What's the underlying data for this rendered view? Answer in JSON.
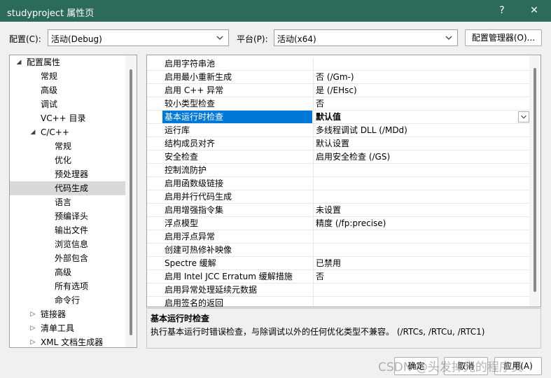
{
  "window": {
    "title": "studyproject 属性页",
    "help_glyph": "?",
    "close_glyph": "✕"
  },
  "config": {
    "label": "配置(C):",
    "value": "活动(Debug)"
  },
  "platform": {
    "label": "平台(P):",
    "value": "活动(x64)"
  },
  "config_manager_label": "配置管理器(O)...",
  "tree": [
    {
      "label": "配置属性",
      "glyph": "◢"
    },
    {
      "label": "常规"
    },
    {
      "label": "高级"
    },
    {
      "label": "调试"
    },
    {
      "label": "VC++ 目录"
    },
    {
      "label": "C/C++",
      "glyph": "◢"
    },
    {
      "label": "常规"
    },
    {
      "label": "优化"
    },
    {
      "label": "预处理器"
    },
    {
      "label": "代码生成"
    },
    {
      "label": "语言"
    },
    {
      "label": "预编译头"
    },
    {
      "label": "输出文件"
    },
    {
      "label": "浏览信息"
    },
    {
      "label": "外部包含"
    },
    {
      "label": "高级"
    },
    {
      "label": "所有选项"
    },
    {
      "label": "命令行"
    },
    {
      "label": "链接器",
      "glyph": "▷"
    },
    {
      "label": "清单工具",
      "glyph": "▷"
    },
    {
      "label": "XML 文档生成器",
      "glyph": "▷"
    }
  ],
  "properties": [
    {
      "name": "启用字符串池",
      "value": ""
    },
    {
      "name": "启用最小重新生成",
      "value": "否 (/Gm-)"
    },
    {
      "name": "启用 C++ 异常",
      "value": "是 (/EHsc)"
    },
    {
      "name": "较小类型检查",
      "value": "否"
    },
    {
      "name": "基本运行时检查",
      "value": "默认值"
    },
    {
      "name": "运行库",
      "value": "多线程调试 DLL (/MDd)"
    },
    {
      "name": "结构成员对齐",
      "value": "默认设置"
    },
    {
      "name": "安全检查",
      "value": "启用安全检查 (/GS)"
    },
    {
      "name": "控制流防护",
      "value": ""
    },
    {
      "name": "启用函数级链接",
      "value": ""
    },
    {
      "name": "启用并行代码生成",
      "value": ""
    },
    {
      "name": "启用增强指令集",
      "value": "未设置"
    },
    {
      "name": "浮点模型",
      "value": "精度 (/fp:precise)"
    },
    {
      "name": "启用浮点异常",
      "value": ""
    },
    {
      "name": "创建可热修补映像",
      "value": ""
    },
    {
      "name": "Spectre 缓解",
      "value": "已禁用"
    },
    {
      "name": "启用 Intel JCC Erratum 缓解措施",
      "value": "否"
    },
    {
      "name": "启用异常处理延续元数据",
      "value": ""
    },
    {
      "name": "启用签名的返回",
      "value": ""
    }
  ],
  "description": {
    "title": "基本运行时检查",
    "text": "执行基本运行时错误检查，与除调试以外的任何优化类型不兼容。     (/RTCs, /RTCu, /RTC1)"
  },
  "buttons": {
    "ok": "确定",
    "cancel": "取消",
    "apply": "应用(A)"
  },
  "watermark": "CSDN @头发掉光的程序员",
  "colors": {
    "titlebar": "#2c6b5a",
    "selection": "#0078d7"
  }
}
